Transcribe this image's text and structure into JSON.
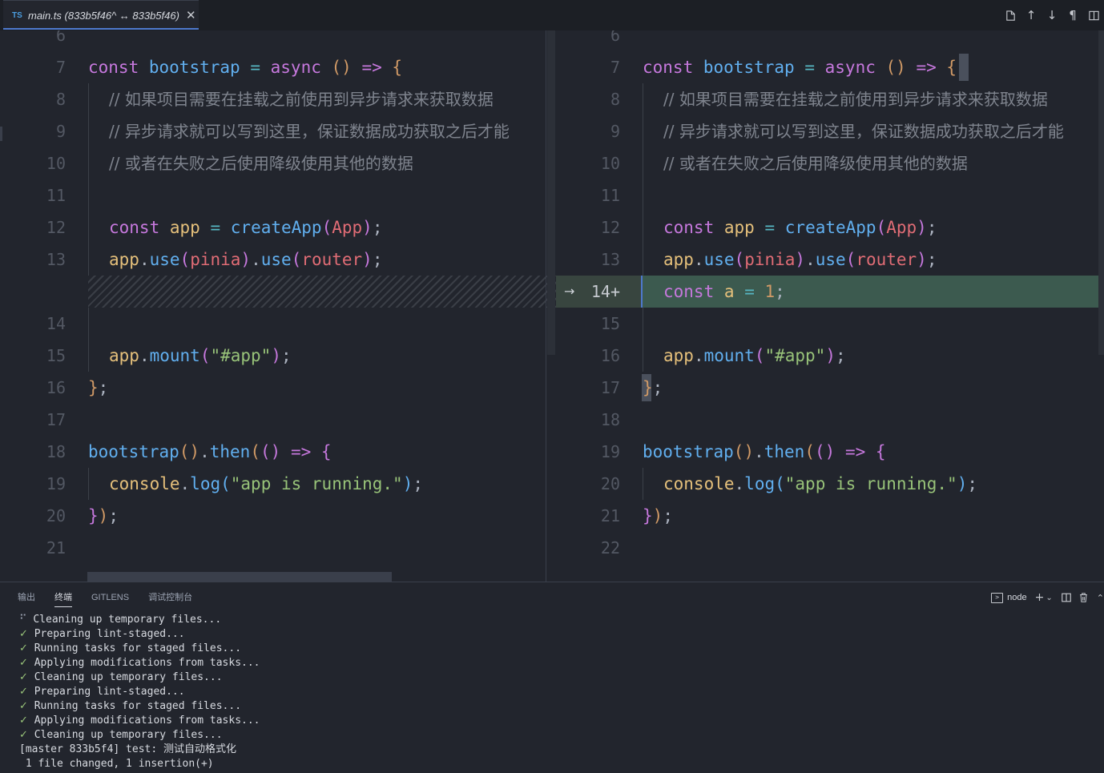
{
  "tab": {
    "lang": "TS",
    "title": "main.ts (833b5f46^ ↔ 833b5f46)",
    "close": "✕"
  },
  "toolbar": {
    "icons": [
      "open-file-icon",
      "arrow-up-icon",
      "arrow-down-icon",
      "pilcrow-icon",
      "split-editor-icon"
    ]
  },
  "colors": {
    "keyword": "#c678dd",
    "variable": "#e5c07b",
    "function": "#61afef",
    "operator": "#56b6c2",
    "string": "#98c379",
    "number": "#d19a66",
    "comment": "#7f848e",
    "added_line": "#3c5a4f",
    "accent": "#4d78cc"
  },
  "left": {
    "line_numbers": [
      "6",
      "7",
      "8",
      "9",
      "10",
      "11",
      "12",
      "13",
      "14",
      "15",
      "16",
      "17",
      "18",
      "19",
      "20",
      "21"
    ],
    "lines": {
      "l7": {
        "kw": "const",
        "name": "bootstrap",
        "op1": "=",
        "kw2": "async",
        "p": "()",
        "op2": "=>",
        "b": "{"
      },
      "l8": "// 如果项目需要在挂载之前使用到异步请求来获取数据",
      "l9": "// 异步请求就可以写到这里，保证数据成功获取之后才能",
      "l10": "// 或者在失败之后使用降级使用其他的数据",
      "l12": {
        "kw": "const",
        "name": "app",
        "op": "=",
        "fn": "createApp",
        "arg": "App",
        "end": ";"
      },
      "l13": {
        "obj": "app",
        "fn1": "use",
        "arg1": "pinia",
        "fn2": "use",
        "arg2": "router",
        "end": ";"
      },
      "l15": {
        "obj": "app",
        "fn": "mount",
        "str": "\"#app\"",
        "end": ";"
      },
      "l16": {
        "b": "}",
        "end": ";"
      },
      "l18": {
        "fn": "bootstrap",
        "fn2": "then",
        "op": "=>",
        "b": "{"
      },
      "l19": {
        "obj": "console",
        "fn": "log",
        "str": "\"app is running.\"",
        "end": ";"
      },
      "l20": {
        "b": "}",
        "p": ")",
        "end": ";"
      }
    }
  },
  "right": {
    "line_numbers": [
      "6",
      "7",
      "8",
      "9",
      "10",
      "11",
      "12",
      "13",
      "14+",
      "15",
      "16",
      "17",
      "18",
      "19",
      "20",
      "21",
      "22"
    ],
    "added_arrow": "→",
    "added_line": {
      "kw": "const",
      "name": "a",
      "op": "=",
      "num": "1",
      "end": ";"
    }
  },
  "panel": {
    "tabs": [
      "输出",
      "终端",
      "GITLENS",
      "调试控制台"
    ],
    "active_tab": "终端",
    "terminal_name": "node",
    "tool_icons": [
      "terminal-icon",
      "add-icon",
      "chevron-down-icon",
      "split-terminal-icon",
      "trash-icon",
      "chevron-up-icon"
    ],
    "terminal_lines": [
      {
        "mark": "⠋",
        "text": "Cleaning up temporary files..."
      },
      {
        "mark": "✓",
        "text": "Preparing lint-staged..."
      },
      {
        "mark": "✓",
        "text": "Running tasks for staged files..."
      },
      {
        "mark": "✓",
        "text": "Applying modifications from tasks..."
      },
      {
        "mark": "✓",
        "text": "Cleaning up temporary files..."
      },
      {
        "mark": "✓",
        "text": "Preparing lint-staged..."
      },
      {
        "mark": "✓",
        "text": "Running tasks for staged files..."
      },
      {
        "mark": "✓",
        "text": "Applying modifications from tasks..."
      },
      {
        "mark": "✓",
        "text": "Cleaning up temporary files..."
      },
      {
        "mark": "",
        "text": "[master 833b5f4] test: 测试自动格式化"
      },
      {
        "mark": "",
        "text": " 1 file changed, 1 insertion(+)"
      }
    ]
  }
}
